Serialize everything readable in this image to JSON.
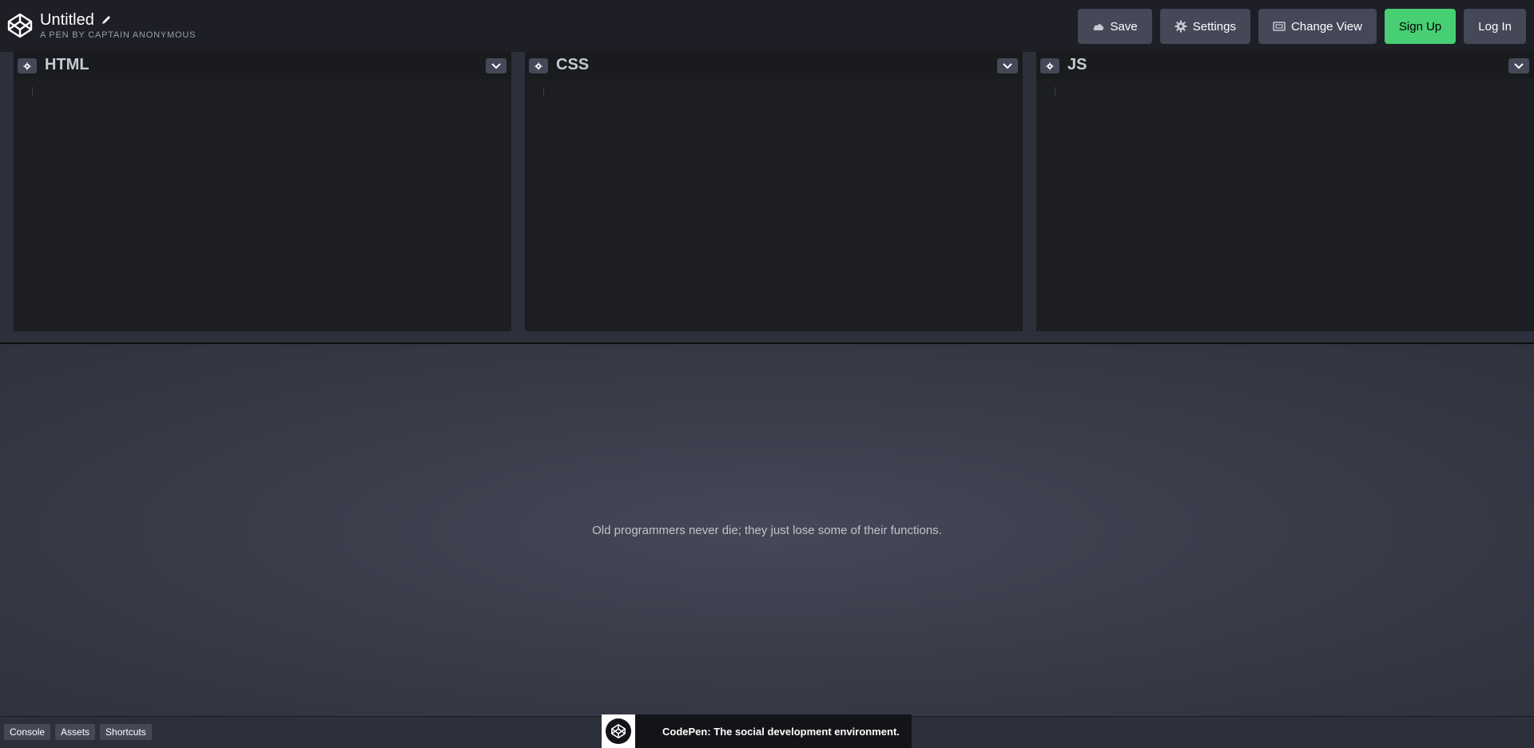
{
  "header": {
    "title": "Untitled",
    "author": "A PEN BY CAPTAIN ANONYMOUS",
    "logo_icon": "codepen-logo-icon",
    "edit_icon": "pencil-icon",
    "buttons": [
      {
        "label": "Save",
        "icon": "cloud-icon"
      },
      {
        "label": "Settings",
        "icon": "gear-icon"
      },
      {
        "label": "Change View",
        "icon": "layout-icon"
      },
      {
        "label": "Sign Up"
      },
      {
        "label": "Log In"
      }
    ],
    "accent_color": "#47cf73"
  },
  "editors": [
    {
      "name": "HTML",
      "gear_icon": "gear-icon",
      "menu_icon": "chevron-down-icon"
    },
    {
      "name": "CSS",
      "gear_icon": "gear-icon",
      "menu_icon": "chevron-down-icon"
    },
    {
      "name": "JS",
      "gear_icon": "gear-icon",
      "menu_icon": "chevron-down-icon"
    }
  ],
  "preview": {
    "message": "Old programmers never die; they just lose some of their functions."
  },
  "footer": {
    "buttons": [
      {
        "label": "Console"
      },
      {
        "label": "Assets"
      },
      {
        "label": "Shortcuts"
      }
    ],
    "promo_text": "CodePen: The social development environment."
  }
}
